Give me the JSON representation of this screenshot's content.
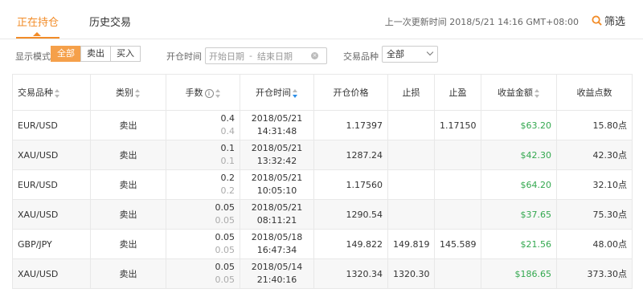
{
  "tabs": [
    {
      "label": "正在持仓",
      "active": true
    },
    {
      "label": "历史交易",
      "active": false
    }
  ],
  "update_time": "上一次更新时间 2018/5/21 14:16 GMT+08:00",
  "filter_label": "筛选",
  "filters": {
    "display_mode_label": "显示模式",
    "display_modes": [
      "全部",
      "卖出",
      "买入"
    ],
    "active_mode": "全部",
    "open_time_label": "开仓时间",
    "start_placeholder": "开始日期",
    "range_separator": "-",
    "end_placeholder": "结束日期",
    "symbol_label": "交易品种",
    "symbol_value": "全部"
  },
  "columns": [
    "交易品种",
    "类别",
    "手数",
    "开仓时间",
    "开仓价格",
    "止损",
    "止盈",
    "收益金额",
    "收益点数"
  ],
  "info_glyph": "i",
  "clear_glyph": "×",
  "rows": [
    {
      "symbol": "EUR/USD",
      "type": "卖出",
      "lots": "0.4",
      "lots_sub": "0.4",
      "date": "2018/05/21",
      "time": "14:31:48",
      "price": "1.17397",
      "sl": "",
      "tp": "1.17150",
      "profit": "$63.20",
      "points": "15.80点"
    },
    {
      "symbol": "XAU/USD",
      "type": "卖出",
      "lots": "0.1",
      "lots_sub": "0.1",
      "date": "2018/05/21",
      "time": "13:32:42",
      "price": "1287.24",
      "sl": "",
      "tp": "",
      "profit": "$42.30",
      "points": "42.30点"
    },
    {
      "symbol": "EUR/USD",
      "type": "卖出",
      "lots": "0.2",
      "lots_sub": "0.2",
      "date": "2018/05/21",
      "time": "10:05:10",
      "price": "1.17560",
      "sl": "",
      "tp": "",
      "profit": "$64.20",
      "points": "32.10点"
    },
    {
      "symbol": "XAU/USD",
      "type": "卖出",
      "lots": "0.05",
      "lots_sub": "0.05",
      "date": "2018/05/21",
      "time": "08:11:21",
      "price": "1290.54",
      "sl": "",
      "tp": "",
      "profit": "$37.65",
      "points": "75.30点"
    },
    {
      "symbol": "GBP/JPY",
      "type": "卖出",
      "lots": "0.05",
      "lots_sub": "0.05",
      "date": "2018/05/18",
      "time": "16:47:34",
      "price": "149.822",
      "sl": "149.819",
      "tp": "145.589",
      "profit": "$21.56",
      "points": "48.00点"
    },
    {
      "symbol": "XAU/USD",
      "type": "卖出",
      "lots": "0.05",
      "lots_sub": "0.05",
      "date": "2018/05/14",
      "time": "21:40:16",
      "price": "1320.34",
      "sl": "1320.30",
      "tp": "",
      "profit": "$186.65",
      "points": "373.30点"
    }
  ],
  "colors": {
    "accent": "#f28c28",
    "profit": "#33a84f",
    "sort_active": "#2b8ee8"
  }
}
